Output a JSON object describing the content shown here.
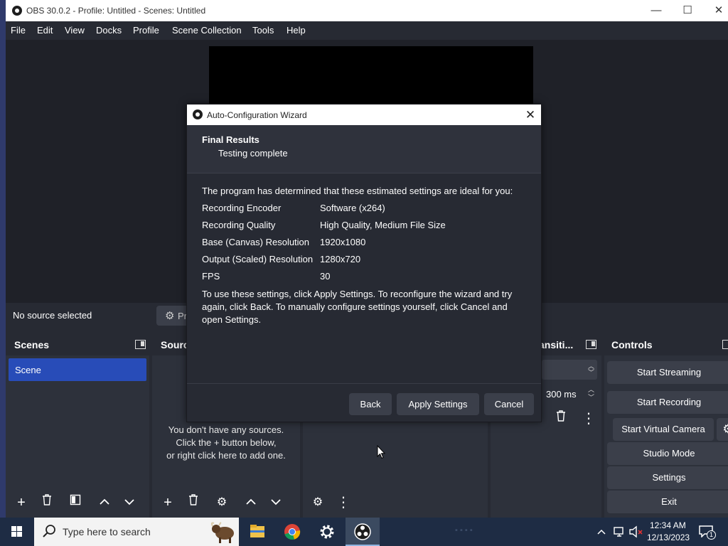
{
  "window": {
    "title": "OBS 30.0.2 - Profile: Untitled - Scenes: Untitled",
    "minimize_glyph": "—",
    "maximize_glyph": "☐",
    "close_glyph": "✕"
  },
  "menu": [
    "File",
    "Edit",
    "View",
    "Docks",
    "Profile",
    "Scene Collection",
    "Tools",
    "Help"
  ],
  "source_toolbar": {
    "status": "No source selected",
    "properties_label": "Pr"
  },
  "docks": {
    "scenes": {
      "title": "Scenes",
      "items": [
        "Scene"
      ]
    },
    "sources": {
      "title": "Sourc",
      "empty_text": [
        "You don't have any sources.",
        "Click the + button below,",
        "or right click here to add one."
      ]
    },
    "transitions": {
      "title": "ansiti...",
      "duration": "300 ms"
    },
    "controls": {
      "title": "Controls",
      "buttons": [
        "Start Streaming",
        "Start Recording",
        "Start Virtual Camera",
        "Studio Mode",
        "Settings",
        "Exit"
      ]
    }
  },
  "dialog": {
    "title": "Auto-Configuration Wizard",
    "close_glyph": "✕",
    "header_title": "Final Results",
    "header_subtitle": "Testing complete",
    "intro": "The program has determined that these estimated settings are ideal for you:",
    "settings": [
      {
        "label": "Recording Encoder",
        "value": "Software (x264)"
      },
      {
        "label": "Recording Quality",
        "value": "High Quality, Medium File Size"
      },
      {
        "label": "Base (Canvas) Resolution",
        "value": "1920x1080"
      },
      {
        "label": "Output (Scaled) Resolution",
        "value": "1280x720"
      },
      {
        "label": "FPS",
        "value": "30"
      }
    ],
    "outro": "To use these settings, click Apply Settings. To reconfigure the wizard and try again, click Back. To manually configure settings yourself, click Cancel and open Settings.",
    "buttons": {
      "back": "Back",
      "apply": "Apply Settings",
      "cancel": "Cancel"
    }
  },
  "taskbar": {
    "search_placeholder": "Type here to search",
    "apps": [
      "file-explorer-icon",
      "chrome-icon",
      "settings-gear-icon",
      "obs-studio-icon"
    ],
    "time": "12:34 AM",
    "date": "12/13/2023",
    "notification_count": "1"
  },
  "colors": {
    "accent": "#284cb8",
    "panel": "#2d313b",
    "window_bg": "#272a33",
    "button": "#3b3f4a"
  }
}
